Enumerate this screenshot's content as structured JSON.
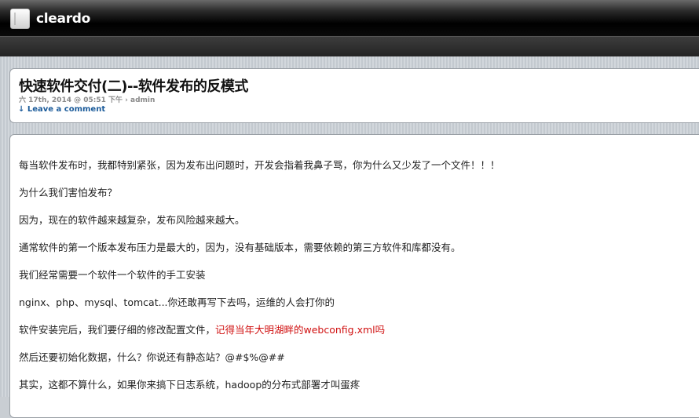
{
  "header": {
    "site_name": "cleardo"
  },
  "post": {
    "title": "快速软件交付(二)--软件发布的反模式",
    "meta": "六 17th, 2014 @ 05:51 下午 › admin",
    "comment_link": "↓ Leave a comment"
  },
  "content": {
    "paragraphs": [
      "每当软件发布时，我都特别紧张，因为发布出问题时，开发会指着我鼻子骂，你为什么又少发了一个文件！！！",
      "为什么我们害怕发布？",
      "因为，现在的软件越来越复杂，发布风险越来越大。",
      "通常软件的第一个版本发布压力是最大的，因为，没有基础版本，需要依赖的第三方软件和库都没有。",
      "我们经常需要一个软件一个软件的手工安装",
      "nginx、php、mysql、tomcat...你还敢再写下去吗，运维的人会打你的",
      "软件安装完后，我们要仔细的修改配置文件，",
      "然后还要初始化数据，什么？你说还有静态站？@#$%@##",
      "其实，这都不算什么，如果你来搞下日志系统，hadoop的分布式部署才叫蛋疼"
    ],
    "highlight": "记得当年大明湖畔的webconfig.xml吗"
  },
  "colors": {
    "highlight": "#d01010",
    "link": "#1b5b9a"
  }
}
